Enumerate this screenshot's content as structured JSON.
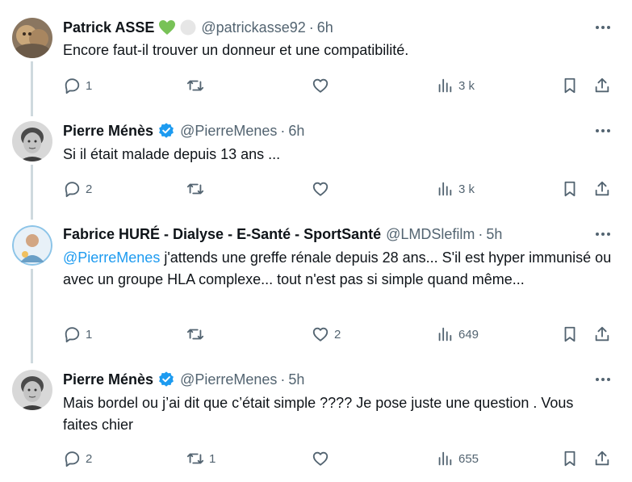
{
  "tweets": [
    {
      "name": "Patrick ASSE",
      "handle": "@patrickasse92",
      "dot": "·",
      "time": "6h",
      "text": "Encore faut-il trouver un donneur et une compatibilité.",
      "replies": "1",
      "retweets": "",
      "likes": "",
      "views": "3 k"
    },
    {
      "name": "Pierre Ménès",
      "handle": "@PierreMenes",
      "dot": "·",
      "time": "6h",
      "text": "Si il était malade depuis 13 ans ...",
      "replies": "2",
      "retweets": "",
      "likes": "",
      "views": "3 k"
    },
    {
      "name": "Fabrice HURÉ - Dialyse - E-Santé - SportSanté",
      "handle": "@LMDSlefilm",
      "dot": "·",
      "time": "5h",
      "mention": "@PierreMenes",
      "text": " j'attends une greffe rénale depuis 28 ans... S'il est hyper immunisé ou avec un groupe HLA complexe... tout n'est pas si simple quand même...",
      "replies": "1",
      "retweets": "",
      "likes": "2",
      "views": "649"
    },
    {
      "name": "Pierre Ménès",
      "handle": "@PierreMenes",
      "dot": "·",
      "time": "5h",
      "text": "Mais bordel ou j’ai dit que c’était simple ???? Je pose juste une question . Vous faites chier",
      "replies": "2",
      "retweets": "1",
      "likes": "",
      "views": "655"
    }
  ],
  "colors": {
    "text": "#0f1419",
    "muted": "#536471",
    "link": "#1d9bf0",
    "verified": "#1d9bf0",
    "heart_badge": "#78c257",
    "thread_line": "#cfd9de"
  },
  "icons": [
    "reply-icon",
    "retweet-icon",
    "like-icon",
    "views-icon",
    "bookmark-icon",
    "share-icon",
    "more-icon",
    "verified-badge-icon"
  ]
}
